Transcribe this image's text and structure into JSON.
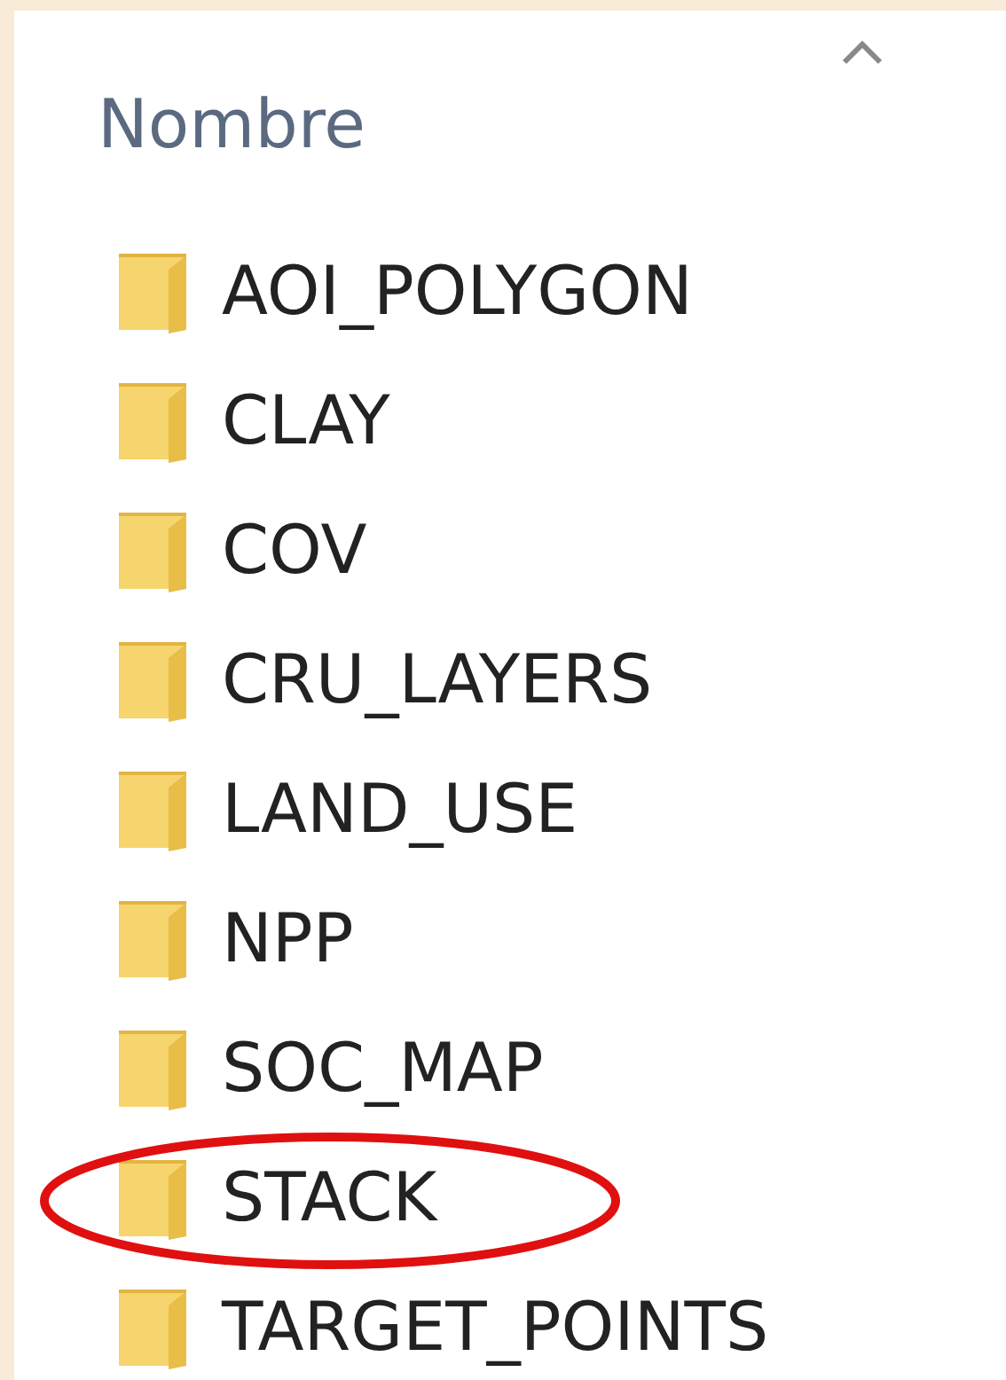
{
  "header": {
    "label": "Nombre",
    "sorted_ascending": true
  },
  "folders": [
    {
      "name": "AOI_POLYGON",
      "circled": false
    },
    {
      "name": "CLAY",
      "circled": false
    },
    {
      "name": "COV",
      "circled": false
    },
    {
      "name": "CRU_LAYERS",
      "circled": false
    },
    {
      "name": "LAND_USE",
      "circled": false
    },
    {
      "name": "NPP",
      "circled": false
    },
    {
      "name": "SOC_MAP",
      "circled": false
    },
    {
      "name": "STACK",
      "circled": true
    },
    {
      "name": "TARGET_POINTS",
      "circled": false
    }
  ]
}
